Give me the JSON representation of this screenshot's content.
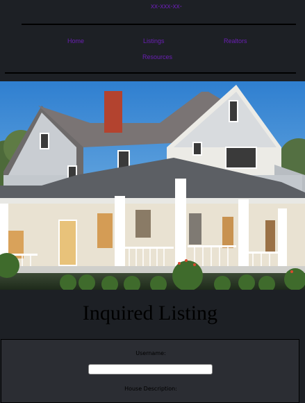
{
  "header": {
    "phone": "xx-xxx-xx-"
  },
  "nav": {
    "home": "Home",
    "listings": "Listings",
    "realtors": "Realtors",
    "resources": "Resources"
  },
  "hero": {
    "icon": "house-photo"
  },
  "page": {
    "title": "Inquired Listing"
  },
  "form": {
    "username_label": "Username:",
    "username_value": "",
    "description_label": "House Description:"
  },
  "colors": {
    "background": "#1d2025",
    "link": "#6a1fb4",
    "form_panel": "#2b2d33"
  }
}
